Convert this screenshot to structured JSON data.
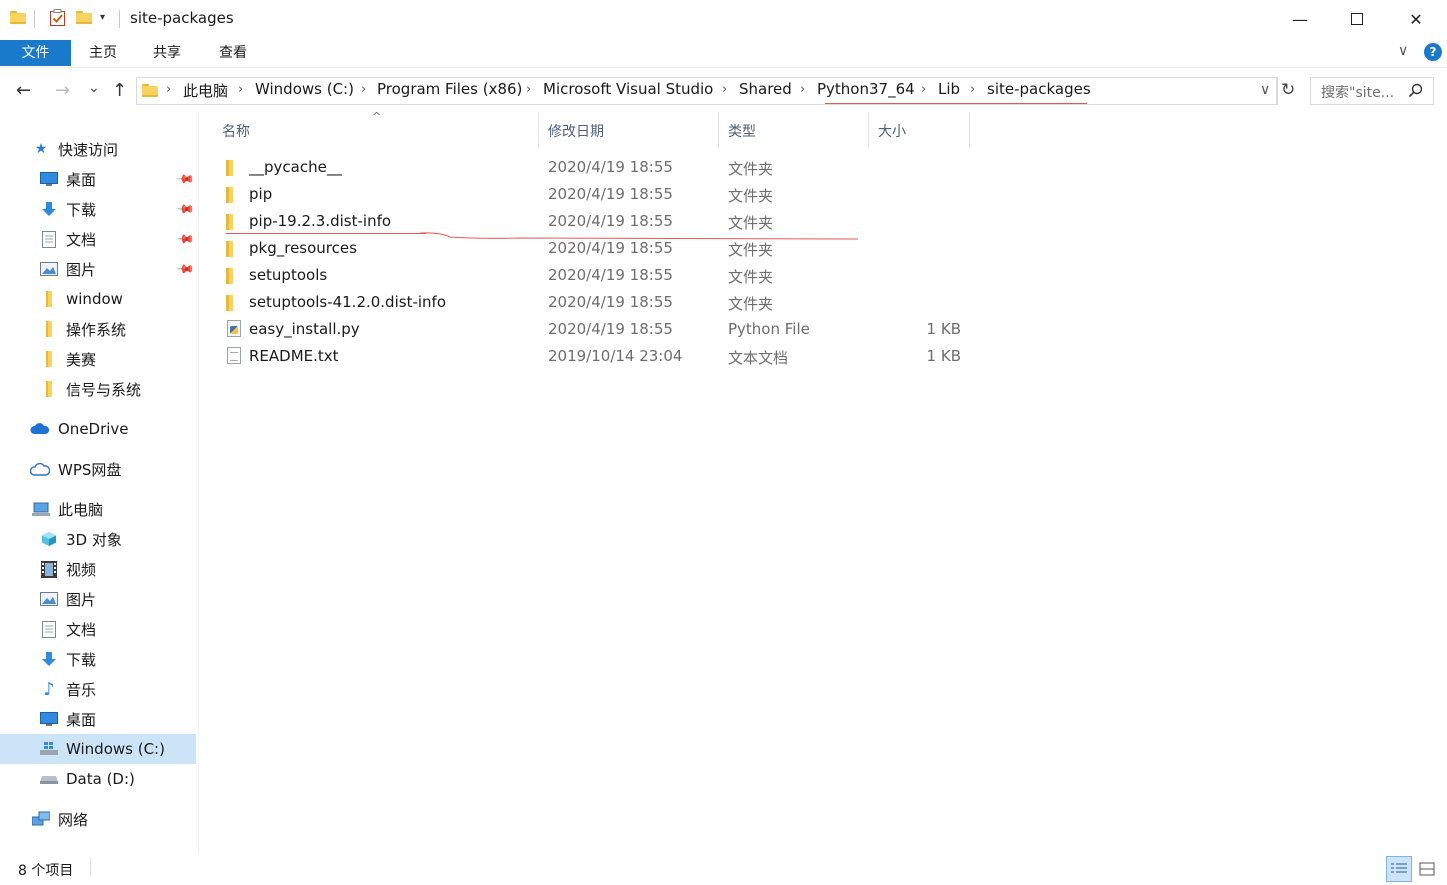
{
  "window": {
    "title": "site-packages",
    "minimize_glyph": "—",
    "maximize_glyph": "☐",
    "close_glyph": "✕"
  },
  "ribbon": {
    "tabs": [
      "文件",
      "主页",
      "共享",
      "查看"
    ],
    "collapse_glyph": "∨",
    "help_glyph": "?"
  },
  "nav": {
    "back": "←",
    "forward": "→",
    "recent": "⌄",
    "up": "↑",
    "refresh": "↻",
    "dropdown": "∨"
  },
  "address": {
    "crumbs": [
      "此电脑",
      "Windows (C:)",
      "Program Files (x86)",
      "Microsoft Visual Studio",
      "Shared",
      "Python37_64",
      "Lib",
      "site-packages"
    ],
    "separator": "›"
  },
  "search": {
    "placeholder": "搜索\"site...",
    "icon": "search-icon"
  },
  "sidebar": {
    "quick_access": "快速访问",
    "qa_items": [
      {
        "label": "桌面",
        "icon": "desktop-icon",
        "pinned": true
      },
      {
        "label": "下载",
        "icon": "download-icon",
        "pinned": true
      },
      {
        "label": "文档",
        "icon": "document-icon",
        "pinned": true
      },
      {
        "label": "图片",
        "icon": "picture-icon",
        "pinned": true
      },
      {
        "label": "window",
        "icon": "folder-icon",
        "pinned": false
      },
      {
        "label": "操作系统",
        "icon": "folder-icon",
        "pinned": false
      },
      {
        "label": "美赛",
        "icon": "folder-icon",
        "pinned": false
      },
      {
        "label": "信号与系统",
        "icon": "folder-icon",
        "pinned": false
      }
    ],
    "onedrive": "OneDrive",
    "wps": "WPS网盘",
    "this_pc": "此电脑",
    "pc_items": [
      {
        "label": "3D 对象",
        "icon": "3d-objects-icon"
      },
      {
        "label": "视频",
        "icon": "video-icon"
      },
      {
        "label": "图片",
        "icon": "picture-icon"
      },
      {
        "label": "文档",
        "icon": "document-icon"
      },
      {
        "label": "下载",
        "icon": "download-icon"
      },
      {
        "label": "音乐",
        "icon": "music-icon"
      },
      {
        "label": "桌面",
        "icon": "desktop-icon"
      },
      {
        "label": "Windows (C:)",
        "icon": "windows-drive-icon",
        "selected": true
      },
      {
        "label": "Data (D:)",
        "icon": "drive-icon"
      }
    ],
    "network": "网络"
  },
  "columns": {
    "name": "名称",
    "date": "修改日期",
    "type": "类型",
    "size": "大小",
    "sort_glyph": "^"
  },
  "files": [
    {
      "name": "__pycache__",
      "date": "2020/4/19 18:55",
      "type": "文件夹",
      "size": "",
      "icon": "folder-icon"
    },
    {
      "name": "pip",
      "date": "2020/4/19 18:55",
      "type": "文件夹",
      "size": "",
      "icon": "folder-icon"
    },
    {
      "name": "pip-19.2.3.dist-info",
      "date": "2020/4/19 18:55",
      "type": "文件夹",
      "size": "",
      "icon": "folder-icon"
    },
    {
      "name": "pkg_resources",
      "date": "2020/4/19 18:55",
      "type": "文件夹",
      "size": "",
      "icon": "folder-icon"
    },
    {
      "name": "setuptools",
      "date": "2020/4/19 18:55",
      "type": "文件夹",
      "size": "",
      "icon": "folder-icon"
    },
    {
      "name": "setuptools-41.2.0.dist-info",
      "date": "2020/4/19 18:55",
      "type": "文件夹",
      "size": "",
      "icon": "folder-icon"
    },
    {
      "name": "easy_install.py",
      "date": "2020/4/19 18:55",
      "type": "Python File",
      "size": "1 KB",
      "icon": "python-file-icon"
    },
    {
      "name": "README.txt",
      "date": "2019/10/14 23:04",
      "type": "文本文档",
      "size": "1 KB",
      "icon": "text-file-icon"
    }
  ],
  "status": {
    "item_count": "8 个项目"
  },
  "colors": {
    "accent": "#1979ca",
    "selection": "#cce4f7",
    "annotation": "#e65858"
  }
}
